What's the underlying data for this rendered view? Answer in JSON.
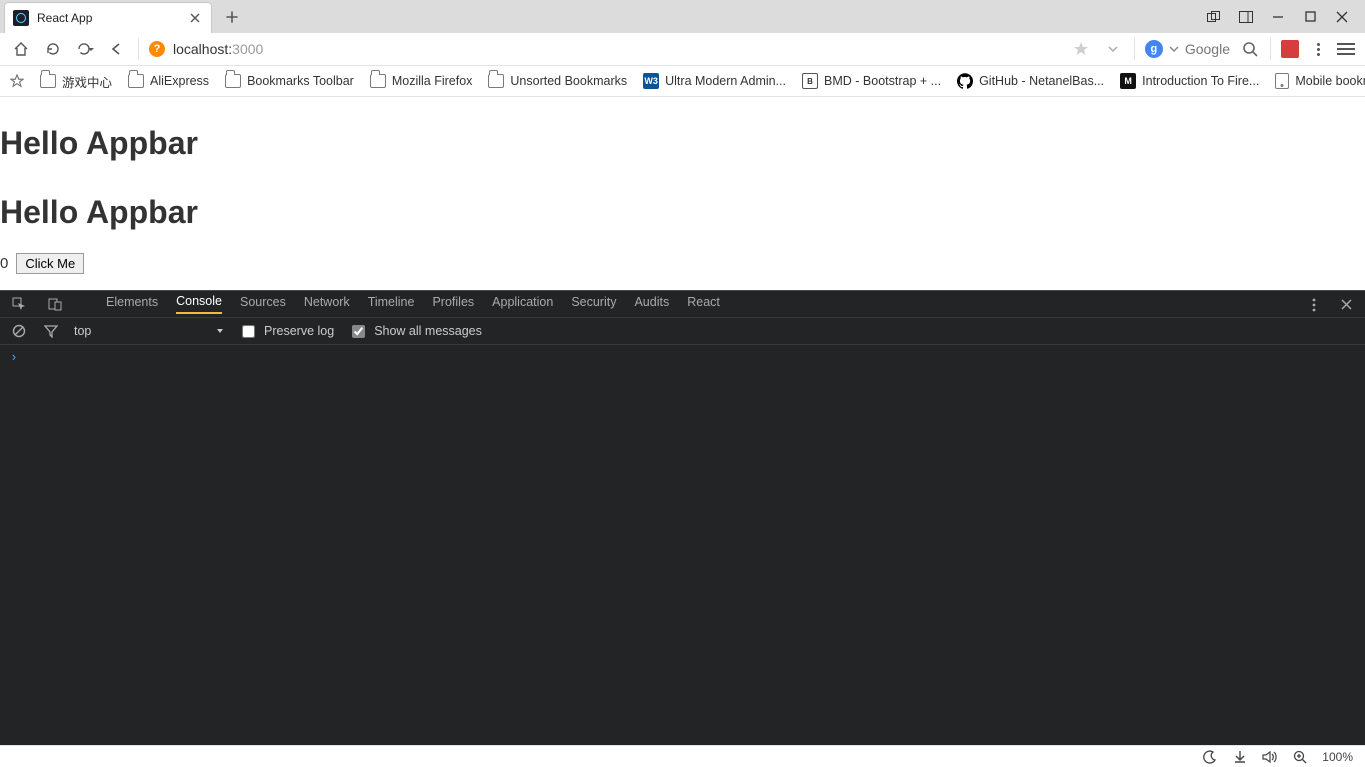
{
  "browser": {
    "tab_title": "React App",
    "new_tab_glyph": "+",
    "window_controls": {
      "two_windows": "⧉",
      "expand": "⧉",
      "minimize": "—",
      "maximize": "▢",
      "close": "✕"
    },
    "url_prefix": "localhost:",
    "url_port": "3000",
    "search": {
      "provider": "Google",
      "letter": "g"
    }
  },
  "bookmarks": {
    "items": [
      {
        "label": "游戏中心",
        "type": "folder"
      },
      {
        "label": "AliExpress",
        "type": "folder"
      },
      {
        "label": "Bookmarks Toolbar",
        "type": "folder"
      },
      {
        "label": "Mozilla Firefox",
        "type": "folder"
      },
      {
        "label": "Unsorted Bookmarks",
        "type": "folder"
      },
      {
        "label": "Ultra Modern Admin...",
        "type": "w3"
      },
      {
        "label": "BMD - Bootstrap + ...",
        "type": "bmd"
      },
      {
        "label": "GitHub - NetanelBas...",
        "type": "github"
      },
      {
        "label": "Introduction To Fire...",
        "type": "medium"
      }
    ],
    "mobile_label": "Mobile bookmarks"
  },
  "page": {
    "heading1": "Hello Appbar",
    "heading2": "Hello Appbar",
    "counter": "0",
    "button_label": "Click Me"
  },
  "devtools": {
    "tabs": [
      "Elements",
      "Console",
      "Sources",
      "Network",
      "Timeline",
      "Profiles",
      "Application",
      "Security",
      "Audits",
      "React"
    ],
    "active_tab": "Console",
    "toolbar": {
      "context": "top",
      "preserve_log_label": "Preserve log",
      "preserve_log_checked": false,
      "show_all_label": "Show all messages",
      "show_all_checked": true
    },
    "prompt": "›"
  },
  "taskbar": {
    "zoom": "100%"
  }
}
